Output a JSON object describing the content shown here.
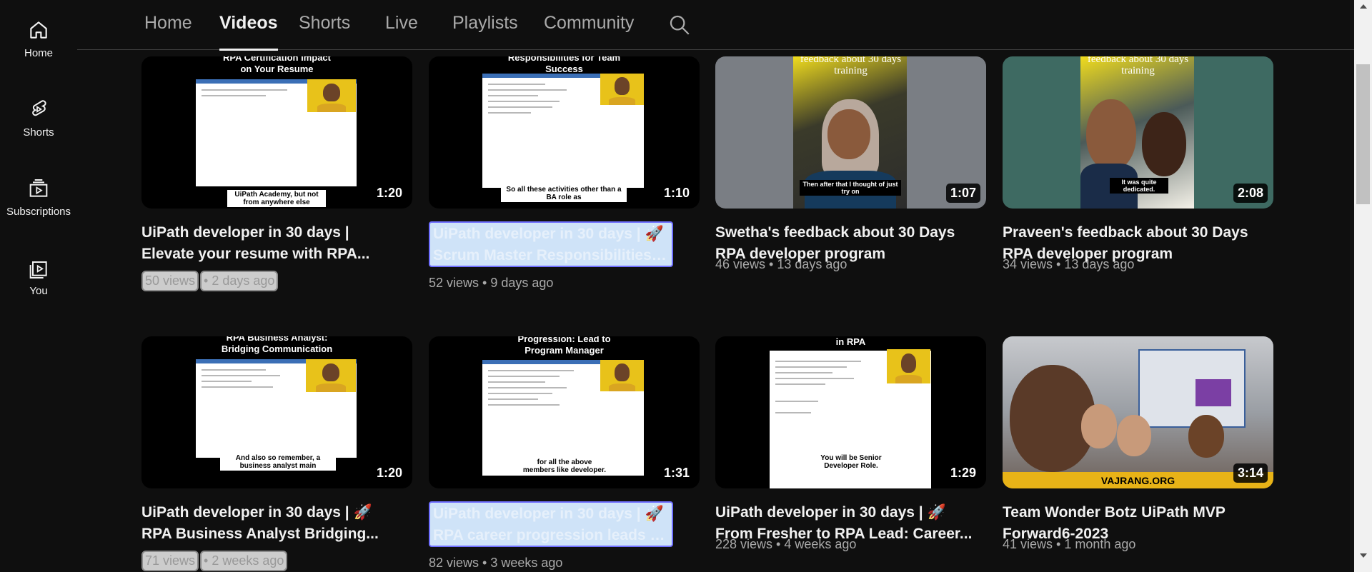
{
  "guide": [
    {
      "label": "Home",
      "icon": "home-icon"
    },
    {
      "label": "Shorts",
      "icon": "shorts-icon"
    },
    {
      "label": "Subscriptions",
      "icon": "subscriptions-icon"
    },
    {
      "label": "You",
      "icon": "you-icon"
    }
  ],
  "tabs": [
    "Home",
    "Videos",
    "Shorts",
    "Live",
    "Playlists",
    "Community"
  ],
  "active_tab": "Videos",
  "videos": [
    {
      "title_l1": "UiPath developer in 30 days |",
      "title_l2": "Elevate your resume with RPA...",
      "views": "50 views",
      "age": "• 2 days ago",
      "duration": "1:20",
      "thumb_top": "RPA Certification Impact\non Your Resume",
      "caption": "UiPath Academy, but not from anywhere else"
    },
    {
      "title_l1": "UiPath developer in 30 days | 🚀",
      "title_l2": "Scrum Master Responsibilities for...",
      "views": "52 views",
      "age": "9 days ago",
      "duration": "1:10",
      "thumb_top": "Responsibilities for Team\nSuccess",
      "caption": "So all these activities other than a BA role as"
    },
    {
      "title_l1": "Swetha's feedback about 30 Days",
      "title_l2": "RPA developer program",
      "views": "46 views",
      "age": "13 days ago",
      "duration": "1:07",
      "thumb_top": "feedback about 30 days\ntraining",
      "caption": "Then after that I thought of just try on"
    },
    {
      "title_l1": "Praveen's feedback about 30 Days",
      "title_l2": "RPA developer program",
      "views": "34 views",
      "age": "13 days ago",
      "duration": "2:08",
      "thumb_top": "feedback about 30 days\ntraining",
      "caption": "It was quite dedicated."
    },
    {
      "title_l1": "UiPath developer in 30 days | 🚀",
      "title_l2": "RPA Business Analyst Bridging...",
      "views": "71 views",
      "age": "• 2 weeks ago",
      "duration": "1:20",
      "thumb_top": "RPA Business Analyst:\nBridging Communication",
      "caption": "And also so remember, a business analyst main"
    },
    {
      "title_l1": "UiPath developer in 30 days | 🚀",
      "title_l2": "RPA career progression leads to...",
      "views": "82 views",
      "age": "3 weeks ago",
      "duration": "1:31",
      "thumb_top": "Progression: Lead to\nProgram Manager",
      "caption": "for all the above members like developer."
    },
    {
      "title_l1": "UiPath developer in 30 days | 🚀",
      "title_l2": "From Fresher to RPA Lead: Career...",
      "views": "228 views",
      "age": "4 weeks ago",
      "duration": "1:29",
      "thumb_top": "in RPA",
      "caption": "You will be Senior Developer Role."
    },
    {
      "title_l1": "Team Wonder Botz UiPath MVP",
      "title_l2": "Forward6-2023",
      "views": "41 views",
      "age": "1 month ago",
      "duration": "3:14",
      "thumb_top": "",
      "caption": "VAJRANG.ORG"
    }
  ]
}
